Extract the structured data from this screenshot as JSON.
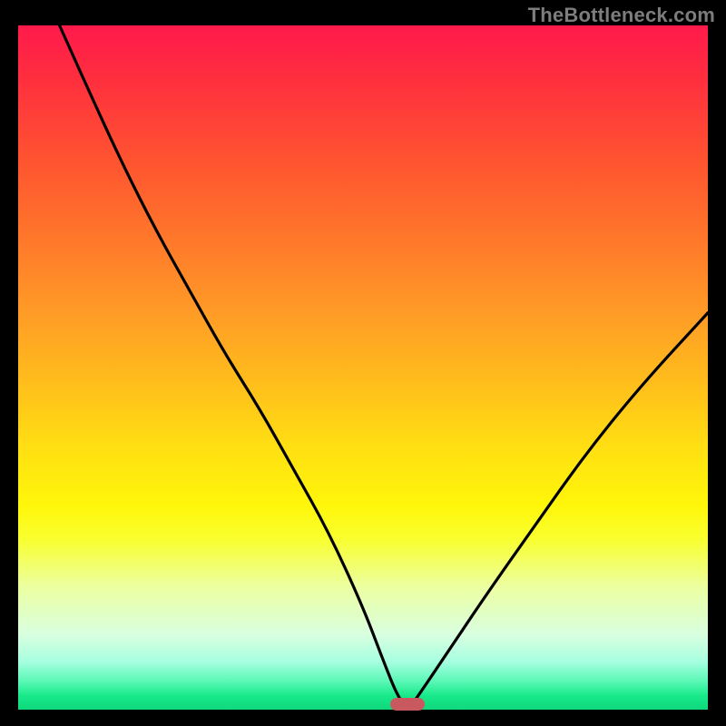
{
  "attribution": "TheBottleneck.com",
  "chart_data": {
    "type": "line",
    "title": "",
    "xlabel": "",
    "ylabel": "",
    "xlim": [
      0,
      100
    ],
    "ylim": [
      0,
      100
    ],
    "grid": false,
    "series": [
      {
        "name": "bottleneck-curve",
        "x": [
          6,
          10,
          15,
          20,
          25,
          30,
          35,
          40,
          45,
          50,
          53,
          55,
          56.5,
          58,
          62,
          68,
          75,
          82,
          90,
          100
        ],
        "values": [
          100,
          91,
          80,
          70,
          61,
          52,
          44,
          35,
          26,
          15,
          7,
          2,
          0,
          2,
          8,
          17,
          27,
          37,
          47,
          58
        ]
      }
    ],
    "marker": {
      "x": 56.5,
      "y": 0.8,
      "color": "#c85a5f"
    },
    "gradient_stops": [
      {
        "pct": 0,
        "color": "#ff1a4b"
      },
      {
        "pct": 50,
        "color": "#ffd016"
      },
      {
        "pct": 100,
        "color": "#0fd87c"
      }
    ]
  }
}
